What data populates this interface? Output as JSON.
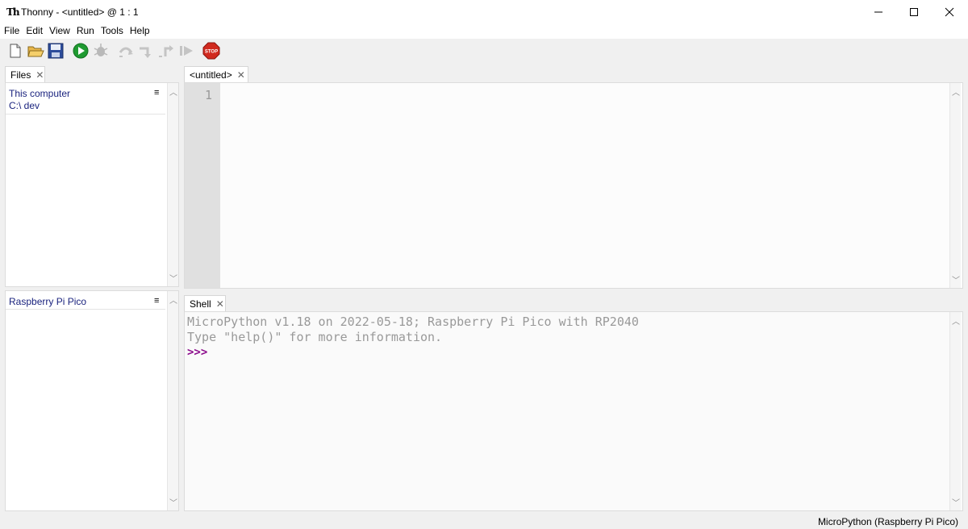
{
  "window": {
    "logo": "Th",
    "title": "Thonny  -  <untitled>  @  1 : 1"
  },
  "menu": [
    "File",
    "Edit",
    "View",
    "Run",
    "Tools",
    "Help"
  ],
  "toolbar": {
    "icons": [
      "new-file-icon",
      "open-file-icon",
      "save-file-icon",
      "run-icon",
      "debug-icon",
      "step-over-icon",
      "step-into-icon",
      "step-out-icon",
      "resume-icon",
      "stop-icon"
    ]
  },
  "files": {
    "tab_label": "Files",
    "section_local_title": "This computer",
    "section_local_path": "C:\\ dev",
    "section_device_title": "Raspberry Pi Pico",
    "menu_glyph": "≡"
  },
  "editor": {
    "tab_label": "<untitled>",
    "line_number": "1"
  },
  "shell": {
    "tab_label": "Shell",
    "line1": "MicroPython v1.18 on 2022-05-18; Raspberry Pi Pico with RP2040",
    "line2": "Type \"help()\" for more information.",
    "prompt": ">>>"
  },
  "status": {
    "interpreter": "MicroPython (Raspberry Pi Pico)"
  },
  "colors": {
    "accent_blue": "#1a237e",
    "prompt_purple": "#8b0a8b",
    "stop_red": "#d12a1f",
    "run_green": "#1f9a31"
  }
}
